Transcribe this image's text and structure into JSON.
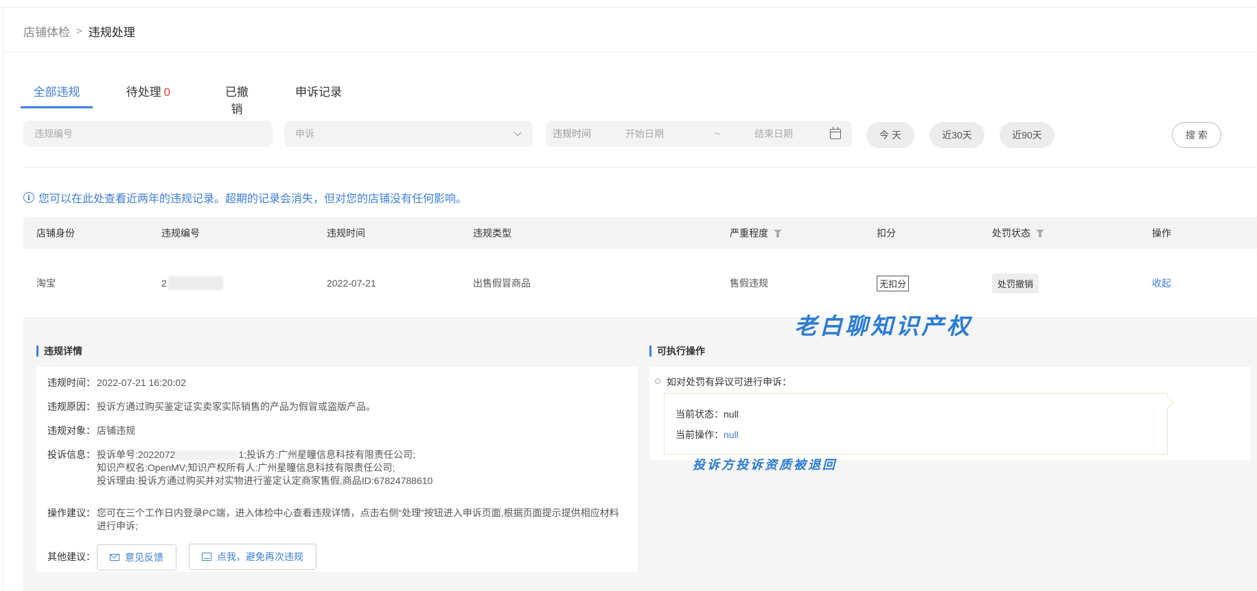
{
  "breadcrumb": {
    "parent": "店铺体检",
    "separator": ">",
    "current": "违规处理"
  },
  "tabs": [
    {
      "label": "全部违规",
      "count": ""
    },
    {
      "label": "待处理",
      "count": "0"
    },
    {
      "label": "已撤销",
      "count": ""
    },
    {
      "label": "申诉记录",
      "count": ""
    }
  ],
  "filters": {
    "violation_id_placeholder": "违规编号",
    "type_value": "申诉",
    "date_label": "违规时间",
    "start_placeholder": "开始日期",
    "tilde": "~",
    "end_placeholder": "结束日期",
    "today": "今 天",
    "last30": "近30天",
    "last90": "近90天",
    "search": "搜 索"
  },
  "notice": "您可以在此处查看近两年的违规记录。超期的记录会消失，但对您的店铺没有任何影响。",
  "table": {
    "headers": [
      "店铺身份",
      "违规编号",
      "违规时间",
      "违规类型",
      "严重程度",
      "扣分",
      "处罚状态",
      "操作"
    ],
    "row": {
      "identity": "淘宝",
      "id_prefix": "2",
      "time": "2022-07-21",
      "type": "出售假冒商品",
      "severity": "售假违规",
      "points": "无扣分",
      "status": "处罚撤销",
      "action": "收起"
    }
  },
  "detail": {
    "title": "违规详情",
    "time_label": "违规时间：",
    "time_value": "2022-07-21 16:20:02",
    "reason_label": "违规原因：",
    "reason_value": "投诉方通过购买鉴定证实卖家实际销售的产品为假冒或盗版产品。",
    "target_label": "违规对象：",
    "target_value": "店铺违规",
    "complaint_label": "投诉信息：",
    "complaint_line1a": "投诉单号:2022072",
    "complaint_line1b": "1;投诉方:广州星瞳信息科技有限责任公司;",
    "complaint_line2": "知识产权名:OpenMV;知识产权所有人:广州星瞳信息科技有限责任公司;",
    "complaint_line3": "投诉理由:投诉方通过购买并对实物进行鉴定认定商家售假,商品ID:67824788610",
    "advice_label": "操作建议：",
    "advice_value": "您可在三个工作日内登录PC端，进入体检中心查看违规详情，点击右侧“处理”按钮进入申诉页面,根据页面提示提供相应材料进行申诉;",
    "other_label": "其他建议：",
    "feedback_btn": "意见反馈",
    "avoid_btn": "点我，避免再次违规"
  },
  "actions": {
    "title": "可执行操作",
    "lead": "如对处罚有异议可进行申诉：",
    "status_label": "当前状态：",
    "status_value": "null",
    "op_label": "当前操作：",
    "op_value": "null"
  },
  "watermarks": {
    "top": "老白聊知识产权",
    "bottom": "投诉方投诉资质被退回"
  }
}
